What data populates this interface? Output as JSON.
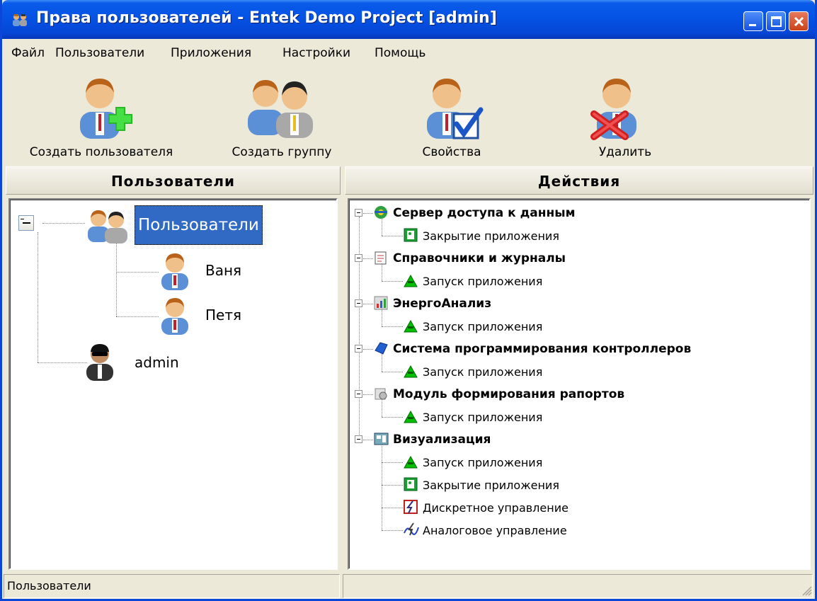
{
  "window": {
    "title": "Права пользователей - Entek Demo Project [admin]"
  },
  "menu": [
    "Файл",
    "Пользователи",
    "Приложения",
    "Настройки",
    "Помощь"
  ],
  "toolbar": {
    "create_user": "Создать пользователя",
    "create_group": "Создать группу",
    "properties": "Свойства",
    "delete": "Удалить"
  },
  "users_panel": {
    "header": "Пользователи",
    "tree": {
      "group_label": "Пользователи",
      "members": [
        "Ваня",
        "Петя"
      ],
      "admin_label": "admin"
    }
  },
  "actions_panel": {
    "header": "Действия",
    "groups": [
      {
        "label": "Сервер доступа к данным",
        "icon": "data-server-icon",
        "items": [
          {
            "label": "Закрытие приложения",
            "icon": "app-close-icon"
          }
        ]
      },
      {
        "label": "Справочники и журналы",
        "icon": "journals-icon",
        "items": [
          {
            "label": "Запуск приложения",
            "icon": "app-launch-icon"
          }
        ]
      },
      {
        "label": "ЭнергоАнализ",
        "icon": "energy-analysis-icon",
        "items": [
          {
            "label": "Запуск приложения",
            "icon": "app-launch-icon"
          }
        ]
      },
      {
        "label": "Система программирования контроллеров",
        "icon": "controller-programming-icon",
        "items": [
          {
            "label": "Запуск приложения",
            "icon": "app-launch-icon"
          }
        ]
      },
      {
        "label": "Модуль формирования рапортов",
        "icon": "report-module-icon",
        "items": [
          {
            "label": "Запуск приложения",
            "icon": "app-launch-icon"
          }
        ]
      },
      {
        "label": "Визуализация",
        "icon": "visualization-icon",
        "items": [
          {
            "label": "Запуск приложения",
            "icon": "app-launch-icon"
          },
          {
            "label": "Закрытие приложения",
            "icon": "app-close-icon"
          },
          {
            "label": "Дискретное управление",
            "icon": "discrete-control-icon"
          },
          {
            "label": "Аналоговое управление",
            "icon": "analog-control-icon"
          }
        ]
      }
    ]
  },
  "statusbar": {
    "left": "Пользователи",
    "right": ""
  },
  "colors": {
    "titlebar": "#0553e4",
    "selection": "#316ac5",
    "window_bg": "#ece9d8",
    "launch_green": "#00c000"
  }
}
